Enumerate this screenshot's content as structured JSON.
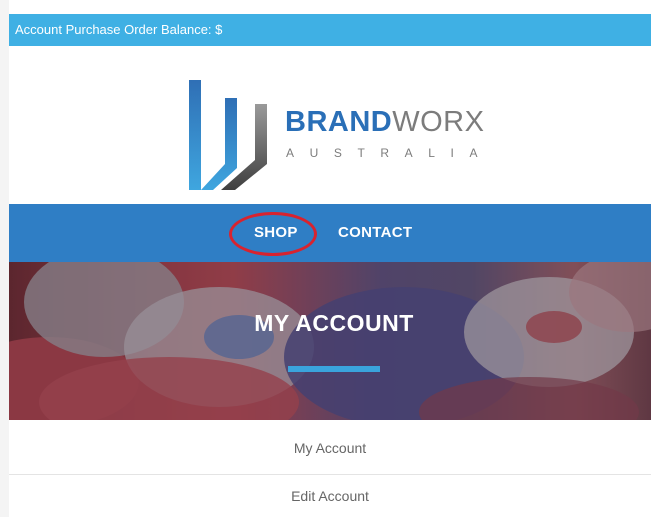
{
  "balance_bar": {
    "text": "Account Purchase Order Balance: $"
  },
  "logo": {
    "brand_bold": "BRAND",
    "brand_light": "WORX",
    "subtitle": "AUSTRALIA"
  },
  "nav": {
    "items": [
      {
        "label": "SHOP"
      },
      {
        "label": "CONTACT"
      }
    ]
  },
  "hero": {
    "title": "MY ACCOUNT"
  },
  "menu": {
    "items": [
      {
        "label": "My Account"
      },
      {
        "label": "Edit Account"
      }
    ]
  },
  "colors": {
    "balance_bar": "#3fb0e4",
    "nav_bar": "#2f7ec5",
    "brand_blue": "#2a6fb7",
    "highlight_circle": "#d8232f",
    "hero_underline": "#3aa4dd"
  }
}
